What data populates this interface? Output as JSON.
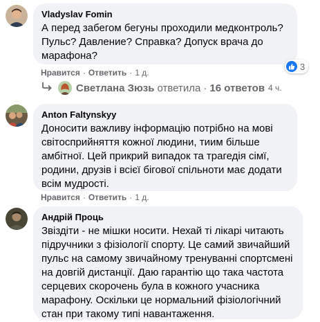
{
  "comments": [
    {
      "author": "Vladyslav Fomin",
      "text": "А перед забегом бегуны проходили медконтроль?\nПульс? Давление? Справка? Допуск врача до\nмарафона?",
      "like_label": "Нравится",
      "reply_label": "Ответить",
      "time": "1 д.",
      "reaction_count": "3"
    },
    {
      "author": "Anton Faltynskyy",
      "text": "Доносити важливу інформацію потрібно на мові\nсвітосприйняття кожної людини, тиим більше\nамбітної. Цей прикрий випадок та трагедія сімї,\nродини, друзів і всієї бігової спільноти має додати\nвсім мудрості.",
      "like_label": "Нравится",
      "reply_label": "Ответить",
      "time": "1 д."
    },
    {
      "author": "Андрій Проць",
      "text": "Звіздіти - не мішки носити. Нехай ті лікарі читають\nпідручники з фізіології спорту. Це самий звичайший\nпульс на самому звичайному тренуванні спортсмені\nна довгій дистанції. Даю гарантію що така частота\nсерцевих скорочень була в кожного учасника\nмарафону. Оскільки це нормальний фізіологічний\nстан при такому типі навантаження."
    }
  ],
  "replies": {
    "name": "Светлана Зюзь",
    "action": "ответила",
    "count_label": "16 ответов",
    "time": "4 ч."
  },
  "colors": {
    "bubble": "#f0f2f5",
    "meta": "#65676b",
    "like_blue": "#1877f2"
  }
}
